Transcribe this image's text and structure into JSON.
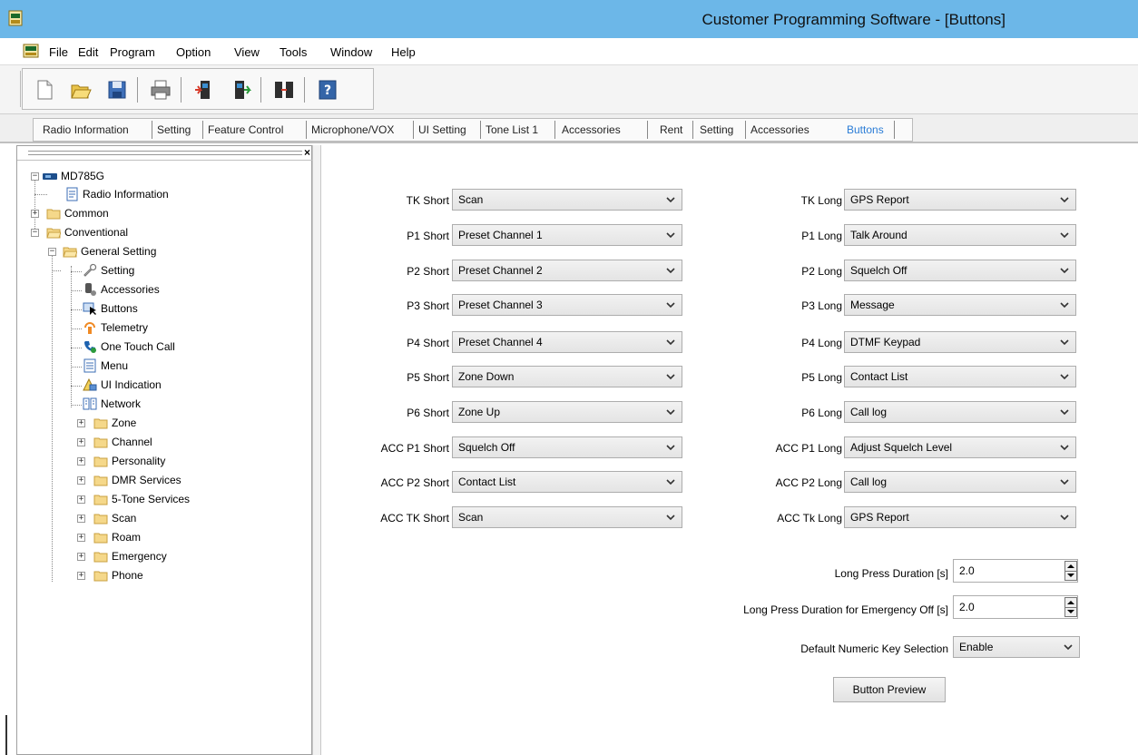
{
  "window": {
    "title": "Customer Programming Software - [Buttons]"
  },
  "menu": [
    "File",
    "Edit",
    "Program",
    "Option",
    "View",
    "Tools",
    "Window",
    "Help"
  ],
  "toolbar": {
    "buttons": [
      "new-icon",
      "open-icon",
      "save-icon",
      "print-icon",
      "read-radio-icon",
      "write-radio-icon",
      "clone-icon",
      "help-icon"
    ]
  },
  "tabs": [
    {
      "label": "Radio Information"
    },
    {
      "label": "Setting"
    },
    {
      "label": "Feature Control"
    },
    {
      "label": "Microphone/VOX"
    },
    {
      "label": "UI Setting"
    },
    {
      "label": "Tone List 1"
    },
    {
      "label": "Accessories"
    },
    {
      "label": "Rent"
    },
    {
      "label": "Setting"
    },
    {
      "label": "Accessories"
    },
    {
      "label": "Buttons",
      "active": true
    }
  ],
  "tree": {
    "root": "MD785G",
    "items": [
      {
        "label": "Radio Information"
      },
      {
        "label": "Common"
      },
      {
        "label": "Conventional"
      },
      {
        "label": "General Setting"
      },
      {
        "label": "Setting"
      },
      {
        "label": "Accessories"
      },
      {
        "label": "Buttons"
      },
      {
        "label": "Telemetry"
      },
      {
        "label": "One Touch Call"
      },
      {
        "label": "Menu"
      },
      {
        "label": "UI Indication"
      },
      {
        "label": "Network"
      },
      {
        "label": "Zone"
      },
      {
        "label": "Channel"
      },
      {
        "label": "Personality"
      },
      {
        "label": "DMR Services"
      },
      {
        "label": "5-Tone Services"
      },
      {
        "label": "Scan"
      },
      {
        "label": "Roam"
      },
      {
        "label": "Emergency"
      },
      {
        "label": "Phone"
      }
    ]
  },
  "buttons": {
    "short": [
      {
        "label": "TK Short",
        "value": "Scan"
      },
      {
        "label": "P1 Short",
        "value": "Preset Channel 1"
      },
      {
        "label": "P2 Short",
        "value": "Preset Channel 2"
      },
      {
        "label": "P3 Short",
        "value": "Preset Channel 3"
      },
      {
        "label": "P4 Short",
        "value": "Preset Channel 4"
      },
      {
        "label": "P5 Short",
        "value": "Zone Down"
      },
      {
        "label": "P6 Short",
        "value": "Zone Up"
      },
      {
        "label": "ACC P1 Short",
        "value": "Squelch Off"
      },
      {
        "label": "ACC P2 Short",
        "value": "Contact List"
      },
      {
        "label": "ACC TK Short",
        "value": "Scan"
      }
    ],
    "long": [
      {
        "label": "TK Long",
        "value": "GPS Report"
      },
      {
        "label": "P1 Long",
        "value": "Talk Around"
      },
      {
        "label": "P2 Long",
        "value": "Squelch Off"
      },
      {
        "label": "P3 Long",
        "value": "Message"
      },
      {
        "label": "P4 Long",
        "value": "DTMF Keypad"
      },
      {
        "label": "P5 Long",
        "value": "Contact List"
      },
      {
        "label": "P6 Long",
        "value": "Call log"
      },
      {
        "label": "ACC P1 Long",
        "value": "Adjust Squelch Level"
      },
      {
        "label": "ACC P2 Long",
        "value": "Call log"
      },
      {
        "label": "ACC Tk Long",
        "value": "GPS Report"
      }
    ]
  },
  "settings": {
    "long_press_label": "Long Press Duration [s]",
    "long_press_value": "2.0",
    "emergency_off_label": "Long Press Duration for Emergency Off [s]",
    "emergency_off_value": "2.0",
    "numeric_key_label": "Default Numeric Key Selection",
    "numeric_key_value": "Enable"
  },
  "preview_button": "Button Preview"
}
